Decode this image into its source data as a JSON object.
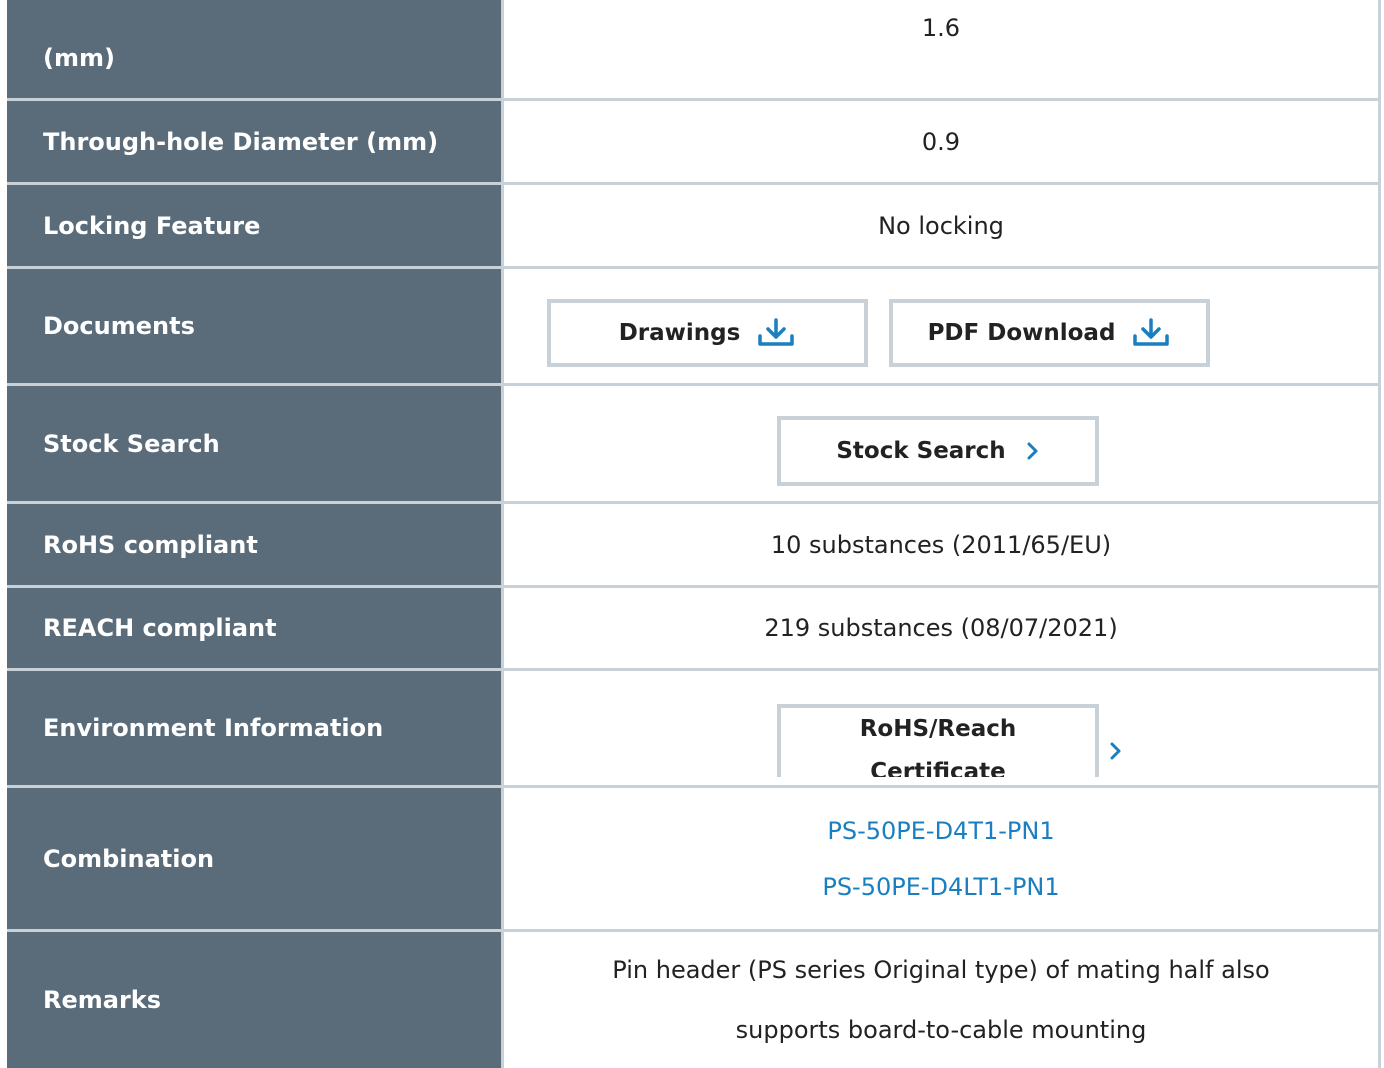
{
  "rows": {
    "pcb_thickness": {
      "label_partial": "(mm)",
      "value": "1.6"
    },
    "through_hole": {
      "label": "Through-hole Diameter (mm)",
      "value": "0.9"
    },
    "locking": {
      "label": "Locking Feature",
      "value": "No locking"
    },
    "documents": {
      "label": "Documents",
      "drawings_label": "Drawings",
      "pdf_label": "PDF Download"
    },
    "stock": {
      "label": "Stock Search",
      "button_label": "Stock Search"
    },
    "rohs": {
      "label": "RoHS compliant",
      "value": "10 substances (2011/65/EU)"
    },
    "reach": {
      "label": "REACH compliant",
      "value": "219 substances (08/07/2021)"
    },
    "environment": {
      "label": "Environment Information",
      "button_line1": "RoHS/Reach",
      "button_line2": "Certificate"
    },
    "combination": {
      "label": "Combination",
      "links": [
        "PS-50PE-D4T1-PN1",
        "PS-50PE-D4LT1-PN1"
      ]
    },
    "remarks": {
      "label": "Remarks",
      "line1": "Pin header (PS series Original type) of mating half also",
      "line2": "supports board-to-cable mounting"
    }
  },
  "icons": {
    "download": "download-icon",
    "chevron": "chevron-right-icon"
  },
  "colors": {
    "label_bg": "#5a6b79",
    "border": "#c9d1d8",
    "link": "#1a7fc1",
    "icon_accent": "#1a7fc1"
  }
}
